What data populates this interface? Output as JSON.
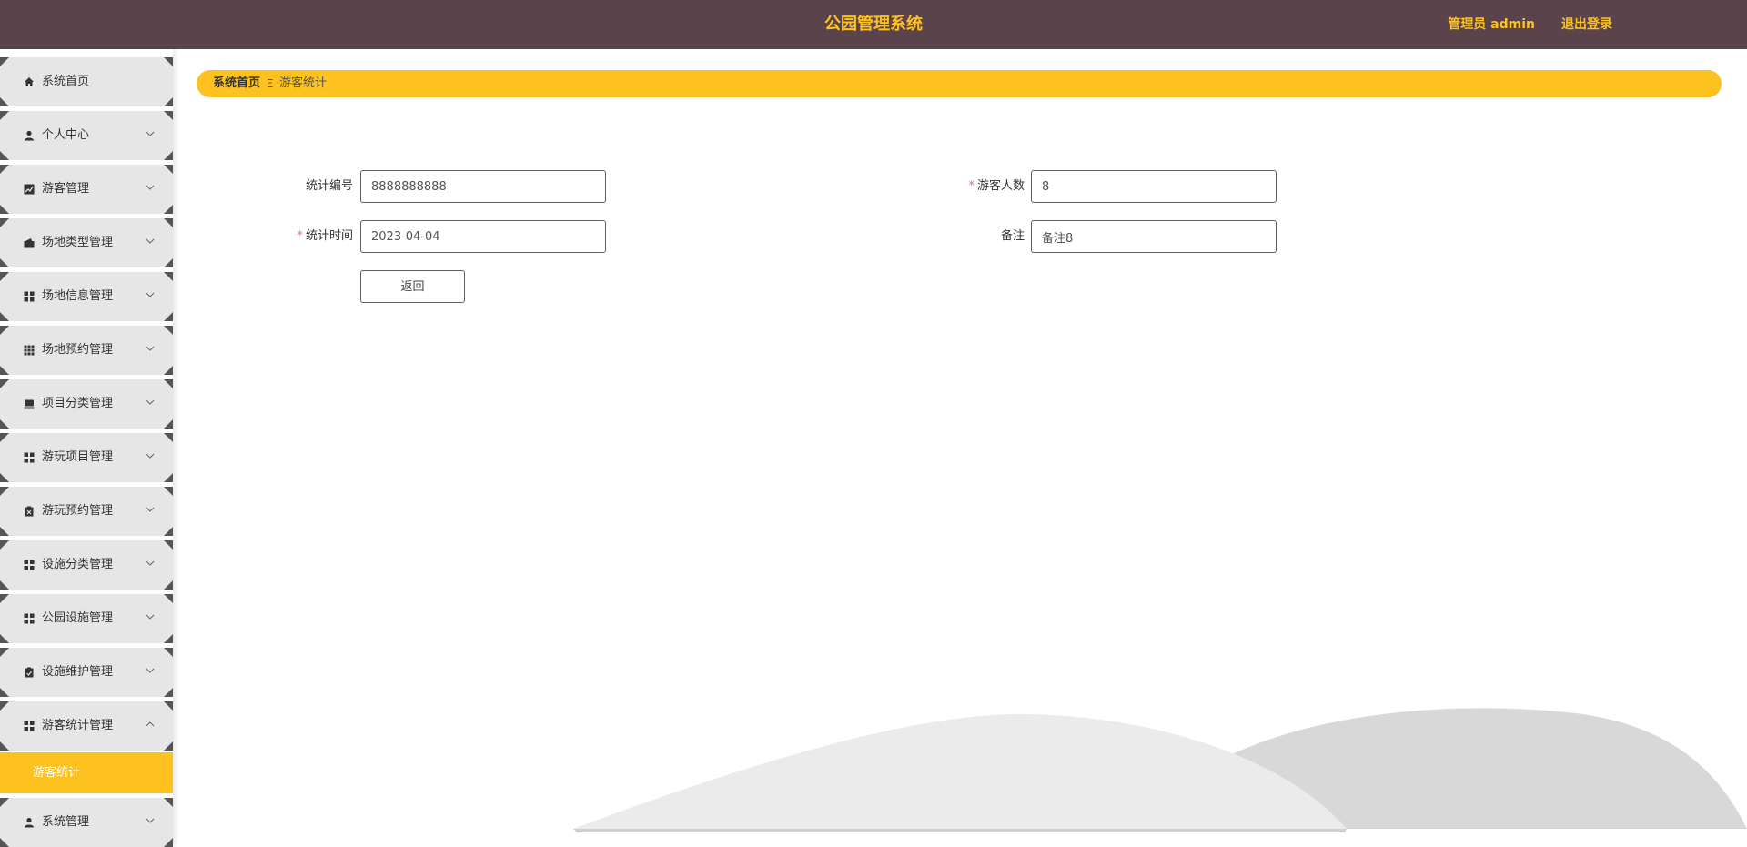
{
  "header": {
    "title": "公园管理系统",
    "user_label": "管理员 admin",
    "logout_label": "退出登录"
  },
  "sidebar": {
    "items": [
      {
        "label": "系统首页",
        "icon": "home-icon"
      },
      {
        "label": "个人中心",
        "icon": "user-icon"
      },
      {
        "label": "游客管理",
        "icon": "chart-icon"
      },
      {
        "label": "场地类型管理",
        "icon": "wallet-icon"
      },
      {
        "label": "场地信息管理",
        "icon": "grid-icon"
      },
      {
        "label": "场地预约管理",
        "icon": "apps-icon"
      },
      {
        "label": "项目分类管理",
        "icon": "tray-icon"
      },
      {
        "label": "游玩项目管理",
        "icon": "grid-icon"
      },
      {
        "label": "游玩预约管理",
        "icon": "clipboard-x-icon"
      },
      {
        "label": "设施分类管理",
        "icon": "grid-icon"
      },
      {
        "label": "公园设施管理",
        "icon": "grid-icon"
      },
      {
        "label": "设施维护管理",
        "icon": "clipboard-check-icon"
      },
      {
        "label": "游客统计管理",
        "icon": "grid-icon"
      }
    ],
    "active_sub": "游客统计",
    "last_item": {
      "label": "系统管理",
      "icon": "user-gear-icon"
    }
  },
  "breadcrumb": {
    "home": "系统首页",
    "separator": "Ξ",
    "current": "游客统计"
  },
  "form": {
    "stat_no_label": "统计编号",
    "stat_no_value": "8888888888",
    "visitors_label": "游客人数",
    "visitors_value": "8",
    "stat_time_label": "统计时间",
    "stat_time_value": "2023-04-04",
    "note_label": "备注",
    "note_value": "备注8",
    "required_mark": "*",
    "back_label": "返回"
  },
  "colors": {
    "header_bg": "#5b434c",
    "accent": "#fdc21f",
    "menu_bg": "#e6e6e6"
  }
}
